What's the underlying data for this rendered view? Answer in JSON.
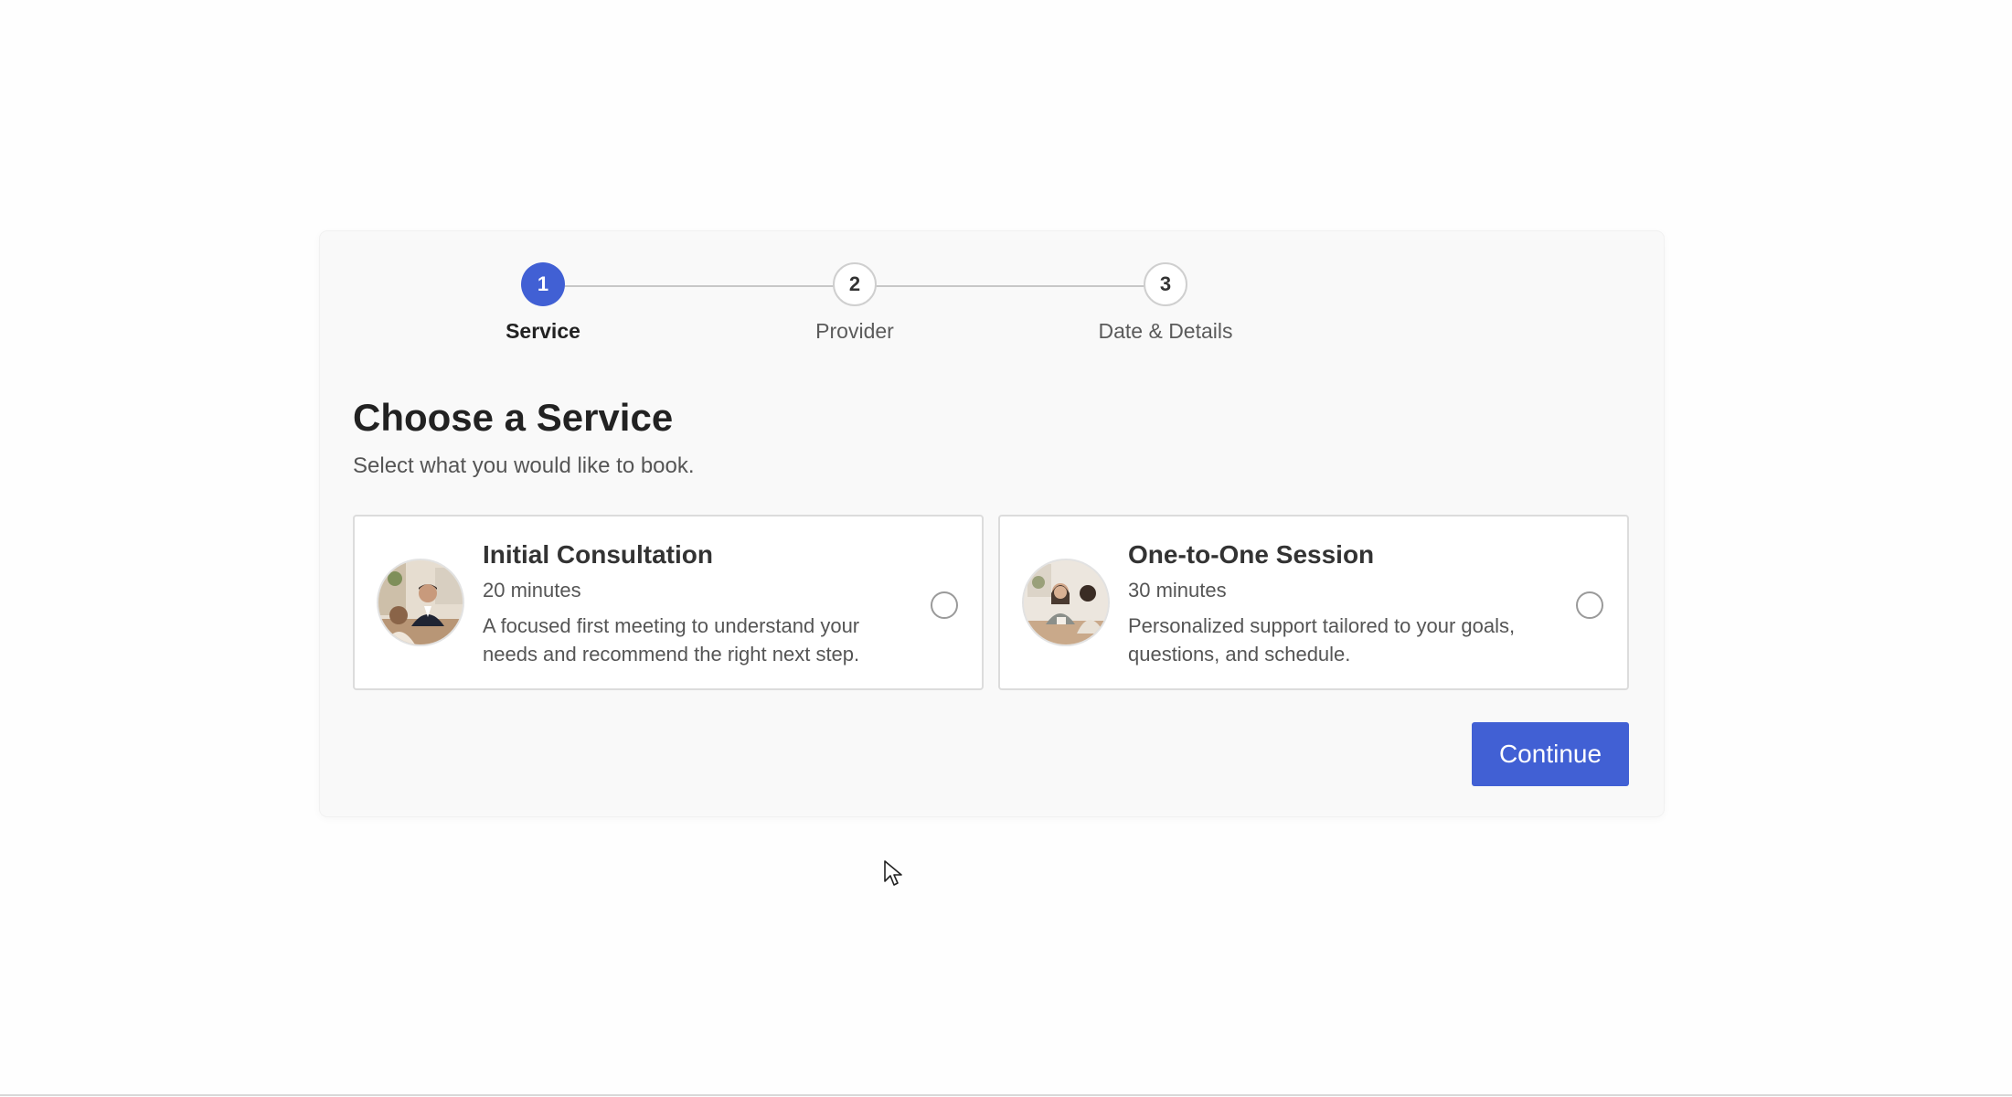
{
  "stepper": {
    "steps": [
      {
        "number": "1",
        "label": "Service",
        "state": "active"
      },
      {
        "number": "2",
        "label": "Provider",
        "state": "inactive"
      },
      {
        "number": "3",
        "label": "Date & Details",
        "state": "inactive"
      }
    ]
  },
  "main": {
    "title": "Choose a Service",
    "subtitle": "Select what you would like to book."
  },
  "services": [
    {
      "title": "Initial Consultation",
      "duration": "20 minutes",
      "description": "A focused first meeting to understand your needs and recommend the right next step.",
      "image_icon": "consultant-photo",
      "selected": false
    },
    {
      "title": "One-to-One Session",
      "duration": "30 minutes",
      "description": "Personalized support tailored to your goals, questions, and schedule.",
      "image_icon": "session-photo",
      "selected": false
    }
  ],
  "actions": {
    "continue_label": "Continue"
  },
  "colors": {
    "accent": "#4160d4",
    "panel_bg": "#f9f9f9",
    "card_border": "#dcdcdc"
  }
}
